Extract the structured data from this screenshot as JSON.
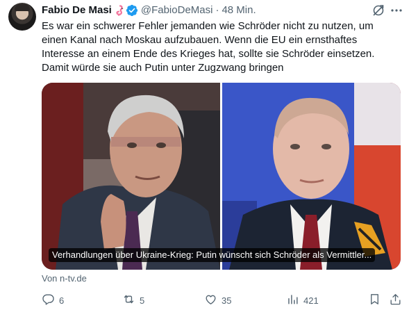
{
  "tweet": {
    "author_name": "Fabio De Masi",
    "author_handle": "@FabioDeMasi",
    "separator": "·",
    "time": "48 Min.",
    "text": "Es war ein schwerer Fehler jemanden wie Schröder nicht zu nutzen, um\neinen Kanal nach Moskau aufzubauen. Wenn die EU ein ernsthaftes\nInteresse an einem Ende des Krieges hat, sollte sie Schröder einsetzen.\nDamit würde sie auch Putin unter Zugzwang bringen",
    "card_title": "Verhandlungen über Ukraine-Krieg: Putin wünscht sich Schröder als Vermittler...",
    "source": "Von n-tv.de",
    "replies": "6",
    "reposts": "5",
    "likes": "35",
    "views": "421",
    "icons": {
      "avatar": "author-avatar",
      "flamingo": "flamingo-emoji",
      "verified": "verified-badge-icon",
      "grok": "grok-icon",
      "more": "more-icon",
      "reply": "reply-icon",
      "repost": "repost-icon",
      "like": "like-icon",
      "views": "views-icon",
      "bookmark": "bookmark-icon",
      "share": "share-icon"
    },
    "colors": {
      "text": "#0f1419",
      "muted": "#536471",
      "verified": "#1d9bf0"
    }
  }
}
